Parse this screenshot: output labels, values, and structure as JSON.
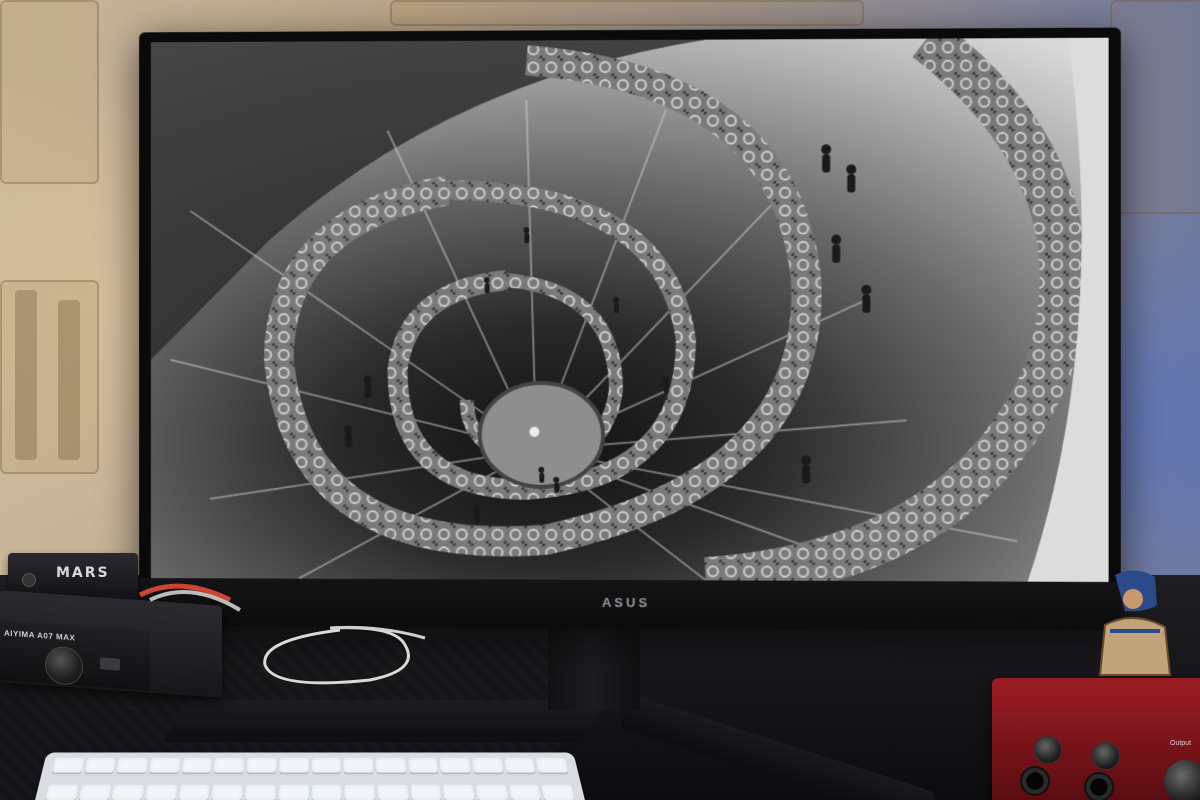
{
  "scene": {
    "description_hidden": false
  },
  "monitor": {
    "brand_label": "ASUS",
    "screen_image": "spiral-staircase-bw"
  },
  "dac": {
    "label": "MARS"
  },
  "amplifier": {
    "label": "AIYIMA A07 MAX"
  },
  "interface": {
    "output_label": "Output"
  },
  "colors": {
    "wallpaper": "#c2ae90",
    "desk": "#16161a",
    "interface_red": "#8a1a20",
    "keyboard": "#e6e8eb"
  },
  "icons": [
    "power-led-icon",
    "volume-knob-icon"
  ]
}
